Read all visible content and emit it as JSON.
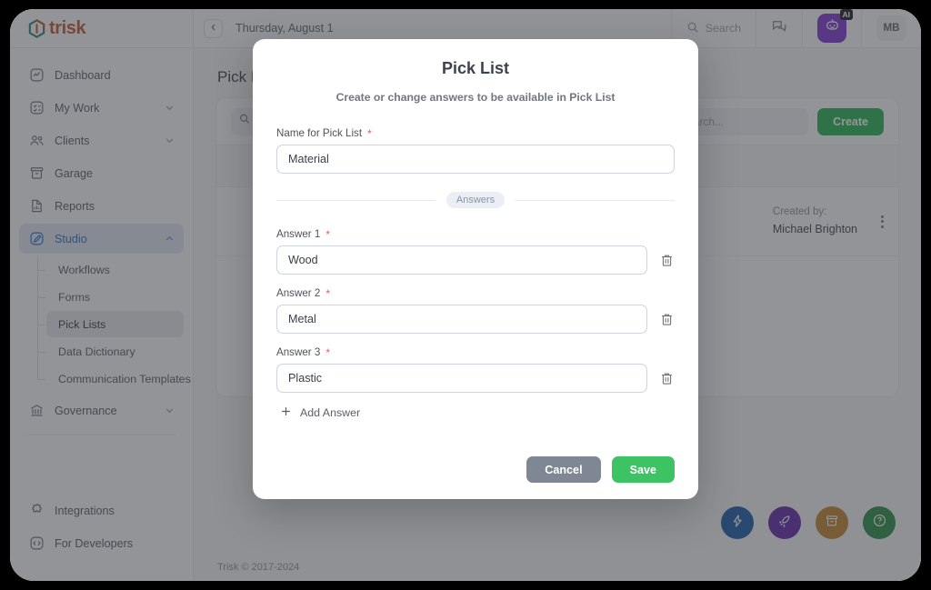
{
  "brand": {
    "name": "trisk",
    "logo_icon": "trisk-hexagon-icon",
    "accent": "#c2522a"
  },
  "topbar": {
    "collapse_icon": "chevron-left-icon",
    "date": "Thursday, August 1",
    "search_label": "Search",
    "search_icon": "search-icon",
    "chat_icon": "chat-bubbles-icon",
    "ai_button_icon": "ai-robot-icon",
    "ai_badge": "AI",
    "avatar_initials": "MB"
  },
  "sidebar": {
    "items": [
      {
        "label": "Dashboard",
        "icon": "dashboard-icon",
        "expandable": false
      },
      {
        "label": "My Work",
        "icon": "checklist-icon",
        "expandable": true
      },
      {
        "label": "Clients",
        "icon": "people-icon",
        "expandable": true
      },
      {
        "label": "Garage",
        "icon": "archive-box-icon",
        "expandable": false
      },
      {
        "label": "Reports",
        "icon": "report-document-icon",
        "expandable": false
      },
      {
        "label": "Studio",
        "icon": "pen-square-icon",
        "expandable": true,
        "active": true,
        "expanded": true
      }
    ],
    "studio_children": [
      {
        "label": "Workflows"
      },
      {
        "label": "Forms"
      },
      {
        "label": "Pick Lists",
        "active": true
      },
      {
        "label": "Data Dictionary"
      },
      {
        "label": "Communication Templates"
      }
    ],
    "governance": {
      "label": "Governance",
      "icon": "bank-icon",
      "expandable": true
    },
    "bottom_items": [
      {
        "label": "Integrations",
        "icon": "puzzle-piece-icon"
      },
      {
        "label": "For Developers",
        "icon": "code-brackets-icon"
      }
    ]
  },
  "page": {
    "title": "Pick Lists",
    "filter_icon": "filter-search-icon",
    "search_placeholder": "Search...",
    "create_label": "Create",
    "create_color": "#22b24c",
    "row": {
      "created_by_label": "Created by:",
      "created_by_value": "Michael Brighton",
      "menu_icon": "kebab-menu-icon"
    },
    "fabs": [
      {
        "icon": "lightning-bolt-icon",
        "color": "#1657a8"
      },
      {
        "icon": "rocket-icon",
        "color": "#5b1ea8"
      },
      {
        "icon": "archive-icon",
        "color": "#c0812b"
      },
      {
        "icon": "question-circle-icon",
        "color": "#1f8b3f"
      }
    ],
    "footer": "Trisk © 2017-2024"
  },
  "modal": {
    "title": "Pick List",
    "subtitle": "Create or change answers to be available in Pick List",
    "name_field": {
      "label": "Name for Pick List",
      "required_mark": "*",
      "value": "Material",
      "placeholder": ""
    },
    "divider_chip": "Answers",
    "answers": [
      {
        "label": "Answer 1",
        "required_mark": "*",
        "value": "Wood",
        "delete_icon": "trash-icon"
      },
      {
        "label": "Answer 2",
        "required_mark": "*",
        "value": "Metal",
        "delete_icon": "trash-icon"
      },
      {
        "label": "Answer 3",
        "required_mark": "*",
        "value": "Plastic",
        "delete_icon": "trash-icon"
      }
    ],
    "add_answer": {
      "label": "Add Answer",
      "icon": "plus-icon"
    },
    "cancel_label": "Cancel",
    "save_label": "Save",
    "cancel_color": "#7f8694",
    "save_color": "#3dc264"
  }
}
